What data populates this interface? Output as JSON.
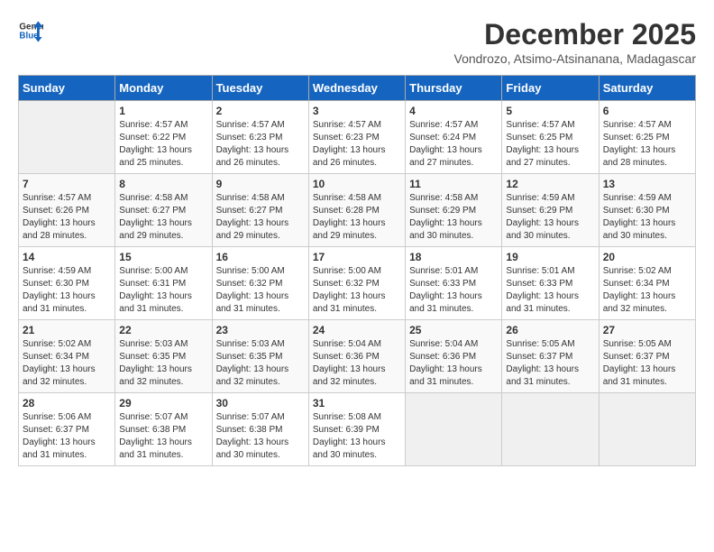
{
  "header": {
    "logo_line1": "General",
    "logo_line2": "Blue",
    "month": "December 2025",
    "location": "Vondrozo, Atsimo-Atsinanana, Madagascar"
  },
  "days_of_week": [
    "Sunday",
    "Monday",
    "Tuesday",
    "Wednesday",
    "Thursday",
    "Friday",
    "Saturday"
  ],
  "weeks": [
    [
      {
        "day": "",
        "empty": true
      },
      {
        "day": "1",
        "sunrise": "4:57 AM",
        "sunset": "6:22 PM",
        "daylight": "13 hours and 25 minutes."
      },
      {
        "day": "2",
        "sunrise": "4:57 AM",
        "sunset": "6:23 PM",
        "daylight": "13 hours and 26 minutes."
      },
      {
        "day": "3",
        "sunrise": "4:57 AM",
        "sunset": "6:23 PM",
        "daylight": "13 hours and 26 minutes."
      },
      {
        "day": "4",
        "sunrise": "4:57 AM",
        "sunset": "6:24 PM",
        "daylight": "13 hours and 27 minutes."
      },
      {
        "day": "5",
        "sunrise": "4:57 AM",
        "sunset": "6:25 PM",
        "daylight": "13 hours and 27 minutes."
      },
      {
        "day": "6",
        "sunrise": "4:57 AM",
        "sunset": "6:25 PM",
        "daylight": "13 hours and 28 minutes."
      }
    ],
    [
      {
        "day": "7",
        "sunrise": "4:57 AM",
        "sunset": "6:26 PM",
        "daylight": "13 hours and 28 minutes."
      },
      {
        "day": "8",
        "sunrise": "4:58 AM",
        "sunset": "6:27 PM",
        "daylight": "13 hours and 29 minutes."
      },
      {
        "day": "9",
        "sunrise": "4:58 AM",
        "sunset": "6:27 PM",
        "daylight": "13 hours and 29 minutes."
      },
      {
        "day": "10",
        "sunrise": "4:58 AM",
        "sunset": "6:28 PM",
        "daylight": "13 hours and 29 minutes."
      },
      {
        "day": "11",
        "sunrise": "4:58 AM",
        "sunset": "6:29 PM",
        "daylight": "13 hours and 30 minutes."
      },
      {
        "day": "12",
        "sunrise": "4:59 AM",
        "sunset": "6:29 PM",
        "daylight": "13 hours and 30 minutes."
      },
      {
        "day": "13",
        "sunrise": "4:59 AM",
        "sunset": "6:30 PM",
        "daylight": "13 hours and 30 minutes."
      }
    ],
    [
      {
        "day": "14",
        "sunrise": "4:59 AM",
        "sunset": "6:30 PM",
        "daylight": "13 hours and 31 minutes."
      },
      {
        "day": "15",
        "sunrise": "5:00 AM",
        "sunset": "6:31 PM",
        "daylight": "13 hours and 31 minutes."
      },
      {
        "day": "16",
        "sunrise": "5:00 AM",
        "sunset": "6:32 PM",
        "daylight": "13 hours and 31 minutes."
      },
      {
        "day": "17",
        "sunrise": "5:00 AM",
        "sunset": "6:32 PM",
        "daylight": "13 hours and 31 minutes."
      },
      {
        "day": "18",
        "sunrise": "5:01 AM",
        "sunset": "6:33 PM",
        "daylight": "13 hours and 31 minutes."
      },
      {
        "day": "19",
        "sunrise": "5:01 AM",
        "sunset": "6:33 PM",
        "daylight": "13 hours and 31 minutes."
      },
      {
        "day": "20",
        "sunrise": "5:02 AM",
        "sunset": "6:34 PM",
        "daylight": "13 hours and 32 minutes."
      }
    ],
    [
      {
        "day": "21",
        "sunrise": "5:02 AM",
        "sunset": "6:34 PM",
        "daylight": "13 hours and 32 minutes."
      },
      {
        "day": "22",
        "sunrise": "5:03 AM",
        "sunset": "6:35 PM",
        "daylight": "13 hours and 32 minutes."
      },
      {
        "day": "23",
        "sunrise": "5:03 AM",
        "sunset": "6:35 PM",
        "daylight": "13 hours and 32 minutes."
      },
      {
        "day": "24",
        "sunrise": "5:04 AM",
        "sunset": "6:36 PM",
        "daylight": "13 hours and 32 minutes."
      },
      {
        "day": "25",
        "sunrise": "5:04 AM",
        "sunset": "6:36 PM",
        "daylight": "13 hours and 31 minutes."
      },
      {
        "day": "26",
        "sunrise": "5:05 AM",
        "sunset": "6:37 PM",
        "daylight": "13 hours and 31 minutes."
      },
      {
        "day": "27",
        "sunrise": "5:05 AM",
        "sunset": "6:37 PM",
        "daylight": "13 hours and 31 minutes."
      }
    ],
    [
      {
        "day": "28",
        "sunrise": "5:06 AM",
        "sunset": "6:37 PM",
        "daylight": "13 hours and 31 minutes."
      },
      {
        "day": "29",
        "sunrise": "5:07 AM",
        "sunset": "6:38 PM",
        "daylight": "13 hours and 31 minutes."
      },
      {
        "day": "30",
        "sunrise": "5:07 AM",
        "sunset": "6:38 PM",
        "daylight": "13 hours and 30 minutes."
      },
      {
        "day": "31",
        "sunrise": "5:08 AM",
        "sunset": "6:39 PM",
        "daylight": "13 hours and 30 minutes."
      },
      {
        "day": "",
        "empty": true
      },
      {
        "day": "",
        "empty": true
      },
      {
        "day": "",
        "empty": true
      }
    ]
  ]
}
